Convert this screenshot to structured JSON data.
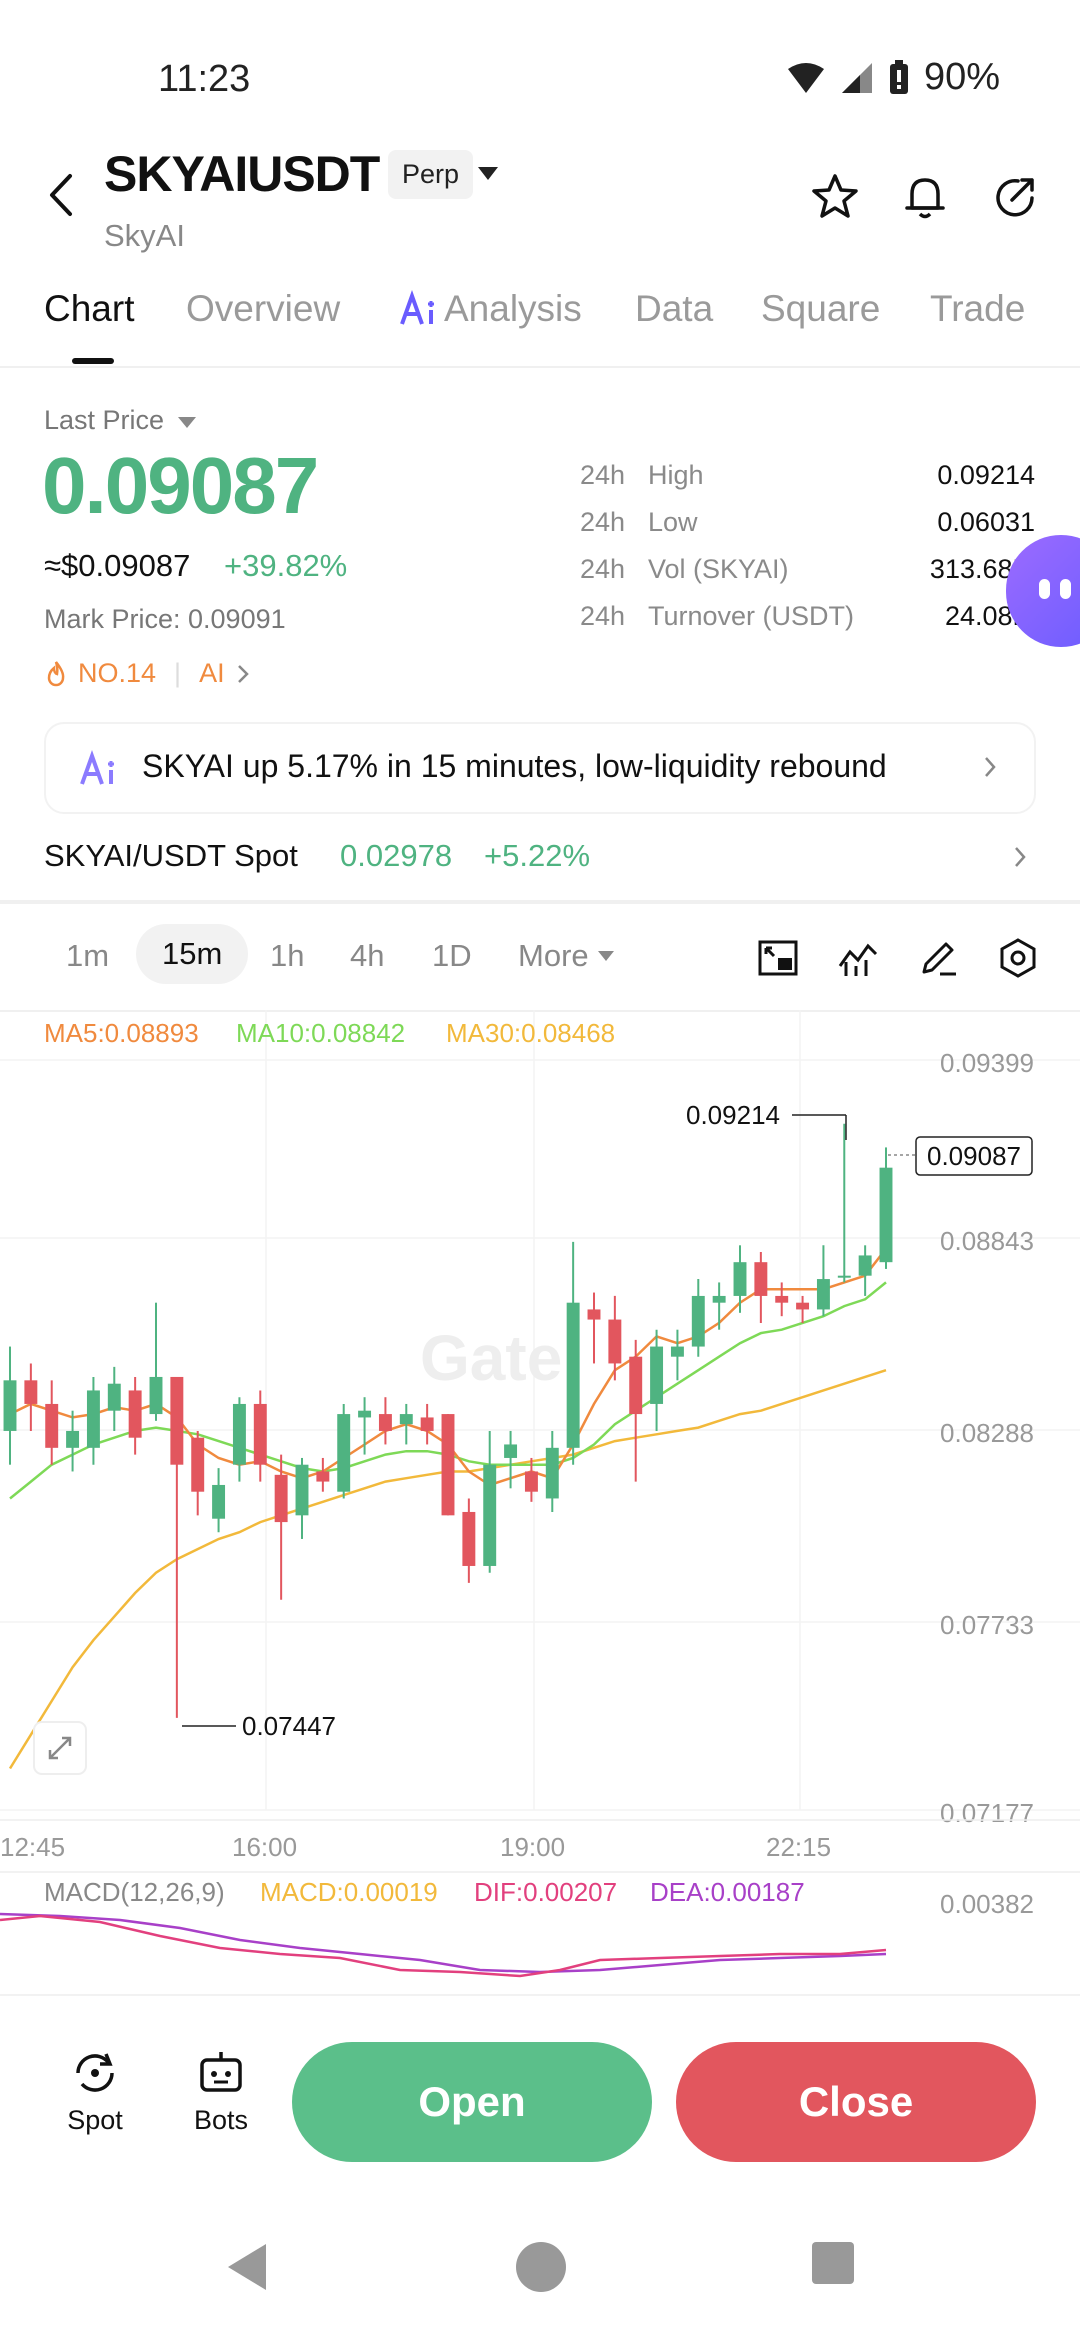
{
  "status": {
    "time": "11:23",
    "battery": "90%"
  },
  "header": {
    "symbol": "SKYAIUSDT",
    "type_badge": "Perp",
    "subtitle": "SkyAI"
  },
  "tabs": [
    "Chart",
    "Overview",
    "Analysis",
    "Data",
    "Square",
    "Trade"
  ],
  "price_panel": {
    "last_price_label": "Last Price",
    "last_price": "0.09087",
    "usd_value": "≈$0.09087",
    "change": "+39.82%",
    "mark_price": "Mark Price: 0.09091",
    "rank": "NO.14",
    "tag": "AI",
    "stats": [
      {
        "k1": "24h",
        "k2": "High",
        "v": "0.09214"
      },
      {
        "k1": "24h",
        "k2": "Low",
        "v": "0.06031"
      },
      {
        "k1": "24h",
        "k2": "Vol (SKYAI)",
        "v": "313.68M"
      },
      {
        "k1": "24h",
        "k2": "Turnover (USDT)",
        "v": "24.08M"
      }
    ]
  },
  "alert": {
    "text": "SKYAI up 5.17% in 15 minutes, low-liquidity rebound"
  },
  "spot": {
    "pair": "SKYAI/USDT Spot",
    "price": "0.02978",
    "change": "+5.22%"
  },
  "timeframes": [
    "1m",
    "15m",
    "1h",
    "4h",
    "1D",
    "More"
  ],
  "chart": {
    "ma5": "MA5:0.08893",
    "ma10": "MA10:0.08842",
    "ma30": "MA30:0.08468",
    "watermark": "Gate",
    "y_labels": [
      "0.09399",
      "0.08843",
      "0.08288",
      "0.07733",
      "0.07177"
    ],
    "x_labels": [
      "12:45",
      "16:00",
      "19:00",
      "22:15"
    ],
    "high_marker": "0.09214",
    "low_marker": "0.07447",
    "current_price": "0.09087",
    "macd_title": "MACD(12,26,9)",
    "macd_val": "MACD:0.00019",
    "dif": "DIF:0.00207",
    "dea": "DEA:0.00187",
    "macd_axis": "0.00382",
    "colors": {
      "up": "#4fb381",
      "down": "#e2565e",
      "ma5": "#f08a3e",
      "ma10": "#7ed957",
      "ma30": "#f2b93b"
    }
  },
  "chart_data": {
    "type": "candlestick",
    "y_range": [
      0.07177,
      0.09399
    ],
    "candles": [
      {
        "o": 0.083,
        "c": 0.0845,
        "h": 0.0855,
        "l": 0.082
      },
      {
        "o": 0.0845,
        "c": 0.0838,
        "h": 0.085,
        "l": 0.083
      },
      {
        "o": 0.0838,
        "c": 0.0825,
        "h": 0.0845,
        "l": 0.082
      },
      {
        "o": 0.0825,
        "c": 0.083,
        "h": 0.0836,
        "l": 0.0818
      },
      {
        "o": 0.0825,
        "c": 0.0842,
        "h": 0.0846,
        "l": 0.082
      },
      {
        "o": 0.0836,
        "c": 0.0844,
        "h": 0.0849,
        "l": 0.083
      },
      {
        "o": 0.0842,
        "c": 0.0828,
        "h": 0.0846,
        "l": 0.0823
      },
      {
        "o": 0.0835,
        "c": 0.0846,
        "h": 0.0868,
        "l": 0.0833
      },
      {
        "o": 0.0846,
        "c": 0.082,
        "h": 0.0846,
        "l": 0.0745
      },
      {
        "o": 0.0828,
        "c": 0.0812,
        "h": 0.083,
        "l": 0.0805
      },
      {
        "o": 0.0804,
        "c": 0.0814,
        "h": 0.0819,
        "l": 0.08
      },
      {
        "o": 0.082,
        "c": 0.0838,
        "h": 0.084,
        "l": 0.0815
      },
      {
        "o": 0.0838,
        "c": 0.082,
        "h": 0.0842,
        "l": 0.0815
      },
      {
        "o": 0.0817,
        "c": 0.0803,
        "h": 0.0823,
        "l": 0.078
      },
      {
        "o": 0.0805,
        "c": 0.082,
        "h": 0.0822,
        "l": 0.0798
      },
      {
        "o": 0.0818,
        "c": 0.0815,
        "h": 0.0822,
        "l": 0.0812
      },
      {
        "o": 0.0812,
        "c": 0.0835,
        "h": 0.0838,
        "l": 0.081
      },
      {
        "o": 0.0834,
        "c": 0.0836,
        "h": 0.084,
        "l": 0.0823
      },
      {
        "o": 0.0835,
        "c": 0.083,
        "h": 0.084,
        "l": 0.0826
      },
      {
        "o": 0.0832,
        "c": 0.0835,
        "h": 0.0838,
        "l": 0.0826
      },
      {
        "o": 0.0834,
        "c": 0.083,
        "h": 0.0838,
        "l": 0.0826
      },
      {
        "o": 0.0835,
        "c": 0.0805,
        "h": 0.0835,
        "l": 0.0805
      },
      {
        "o": 0.0806,
        "c": 0.079,
        "h": 0.081,
        "l": 0.0785
      },
      {
        "o": 0.079,
        "c": 0.082,
        "h": 0.083,
        "l": 0.0788
      },
      {
        "o": 0.0822,
        "c": 0.0826,
        "h": 0.083,
        "l": 0.0813
      },
      {
        "o": 0.0818,
        "c": 0.0812,
        "h": 0.0822,
        "l": 0.0809
      },
      {
        "o": 0.081,
        "c": 0.0825,
        "h": 0.083,
        "l": 0.0806
      },
      {
        "o": 0.0825,
        "c": 0.0868,
        "h": 0.0886,
        "l": 0.082
      },
      {
        "o": 0.0866,
        "c": 0.0863,
        "h": 0.0871,
        "l": 0.085
      },
      {
        "o": 0.0863,
        "c": 0.085,
        "h": 0.087,
        "l": 0.0845
      },
      {
        "o": 0.0852,
        "c": 0.0835,
        "h": 0.0857,
        "l": 0.0815
      },
      {
        "o": 0.0838,
        "c": 0.0855,
        "h": 0.086,
        "l": 0.083
      },
      {
        "o": 0.0852,
        "c": 0.0855,
        "h": 0.086,
        "l": 0.0845
      },
      {
        "o": 0.0855,
        "c": 0.087,
        "h": 0.0875,
        "l": 0.0852
      },
      {
        "o": 0.0868,
        "c": 0.087,
        "h": 0.0874,
        "l": 0.086
      },
      {
        "o": 0.087,
        "c": 0.088,
        "h": 0.0885,
        "l": 0.0865
      },
      {
        "o": 0.088,
        "c": 0.087,
        "h": 0.0883,
        "l": 0.0862
      },
      {
        "o": 0.087,
        "c": 0.0868,
        "h": 0.0874,
        "l": 0.0864
      },
      {
        "o": 0.0868,
        "c": 0.0866,
        "h": 0.087,
        "l": 0.0862
      },
      {
        "o": 0.0866,
        "c": 0.0875,
        "h": 0.0885,
        "l": 0.0864
      },
      {
        "o": 0.0876,
        "c": 0.0876,
        "h": 0.0921,
        "l": 0.0874
      },
      {
        "o": 0.0876,
        "c": 0.0882,
        "h": 0.0885,
        "l": 0.087
      },
      {
        "o": 0.088,
        "c": 0.0908,
        "h": 0.0914,
        "l": 0.0878
      }
    ],
    "ma5": [
      0.0835,
      0.0838,
      0.0836,
      0.0834,
      0.0835,
      0.0837,
      0.0836,
      0.0838,
      0.0834,
      0.0826,
      0.0822,
      0.082,
      0.0821,
      0.0818,
      0.0816,
      0.0818,
      0.0822,
      0.0826,
      0.083,
      0.0832,
      0.083,
      0.0826,
      0.0818,
      0.0814,
      0.0816,
      0.0818,
      0.0816,
      0.0826,
      0.0838,
      0.0848,
      0.0852,
      0.0858,
      0.0856,
      0.0858,
      0.0862,
      0.0868,
      0.0872,
      0.0872,
      0.0872,
      0.0872,
      0.0874,
      0.0876,
      0.0884
    ],
    "ma10": [
      0.081,
      0.0815,
      0.082,
      0.0823,
      0.0826,
      0.0828,
      0.083,
      0.0831,
      0.083,
      0.0829,
      0.0827,
      0.0825,
      0.0823,
      0.0821,
      0.0819,
      0.0818,
      0.0819,
      0.0821,
      0.0823,
      0.0824,
      0.0824,
      0.0823,
      0.0821,
      0.082,
      0.082,
      0.082,
      0.082,
      0.0822,
      0.0826,
      0.0832,
      0.0836,
      0.084,
      0.0844,
      0.0848,
      0.0852,
      0.0856,
      0.0859,
      0.086,
      0.0862,
      0.0864,
      0.0867,
      0.0869,
      0.0874
    ],
    "ma30": [
      0.073,
      0.074,
      0.075,
      0.076,
      0.0768,
      0.0775,
      0.0782,
      0.0788,
      0.0792,
      0.0795,
      0.0798,
      0.08,
      0.0803,
      0.0805,
      0.0807,
      0.0809,
      0.0811,
      0.0813,
      0.0815,
      0.0816,
      0.0817,
      0.0818,
      0.0818,
      0.0819,
      0.082,
      0.0821,
      0.0822,
      0.0823,
      0.0825,
      0.0827,
      0.0828,
      0.0829,
      0.083,
      0.0831,
      0.0833,
      0.0835,
      0.0836,
      0.0838,
      0.084,
      0.0842,
      0.0844,
      0.0846,
      0.0848
    ]
  },
  "bottom": {
    "spot_label": "Spot",
    "bots_label": "Bots",
    "open": "Open",
    "close": "Close"
  }
}
